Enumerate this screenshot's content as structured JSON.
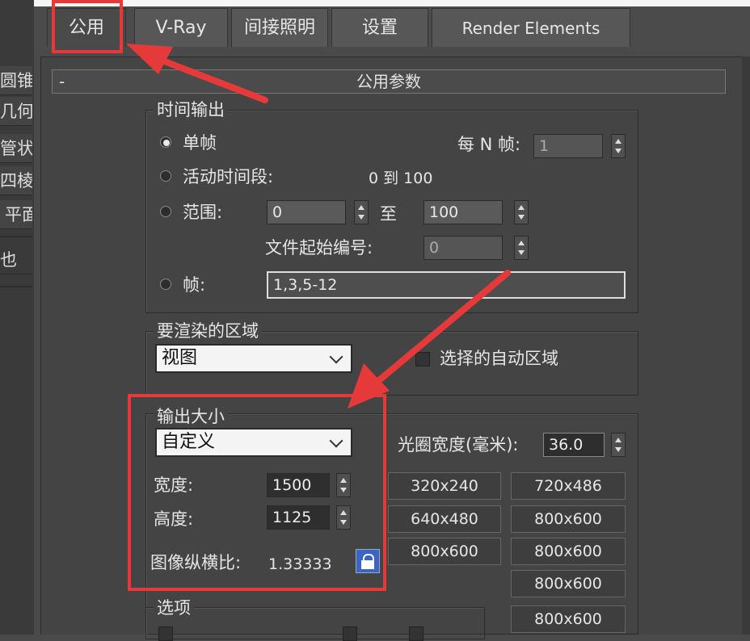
{
  "left_strip": {
    "items": [
      "圆锥",
      "几何球",
      "管状",
      "四棱",
      "平面",
      "也"
    ]
  },
  "tabs": [
    "公用",
    "V-Ray",
    "间接照明",
    "设置",
    "Render Elements"
  ],
  "rollout": {
    "collapse": "-",
    "title": "公用参数"
  },
  "time_output": {
    "legend": "时间输出",
    "single": "单帧",
    "every_n_label": "每 N 帧:",
    "every_n_value": "1",
    "active_segment": "活动时间段:",
    "active_range": "0 到 100",
    "range": "范围:",
    "range_start": "0",
    "range_to": "至",
    "range_end": "100",
    "file_number_label": "文件起始编号:",
    "file_number_value": "0",
    "frames": "帧:",
    "frames_value": "1,3,5-12"
  },
  "area": {
    "legend": "要渲染的区域",
    "dropdown": "视图",
    "auto_region": "选择的自动区域"
  },
  "output_size": {
    "legend": "输出大小",
    "dropdown": "自定义",
    "aperture_label": "光圈宽度(毫米):",
    "aperture_value": "36.0",
    "width_label": "宽度:",
    "width_value": "1500",
    "height_label": "高度:",
    "height_value": "1125",
    "aspect_label": "图像纵横比:",
    "aspect_value": "1.33333",
    "presets": [
      "320x240",
      "720x486",
      "640x480",
      "800x600",
      "800x600",
      "800x600",
      "800x600",
      "800x600"
    ]
  },
  "options": {
    "legend": "选项"
  },
  "colors": {
    "highlight": "#e63a3a",
    "lock": "#3b64c8"
  }
}
